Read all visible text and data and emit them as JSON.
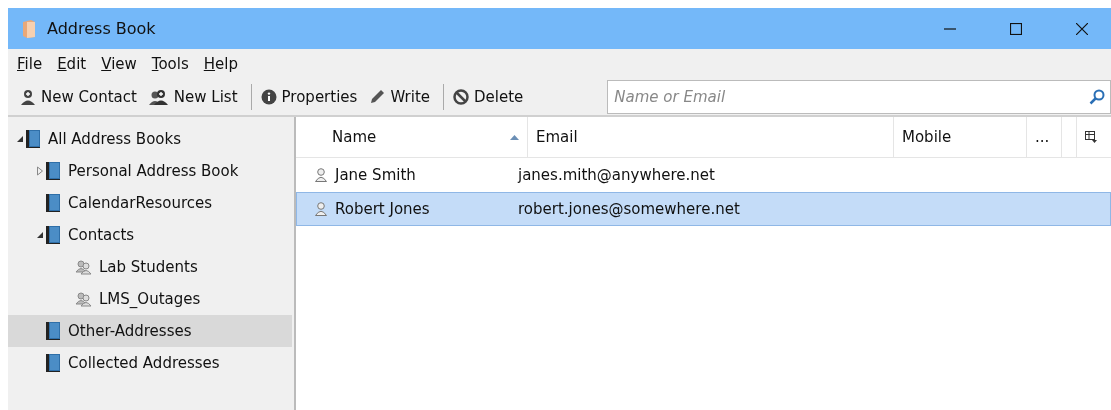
{
  "window": {
    "title": "Address Book"
  },
  "menu": [
    "File",
    "Edit",
    "View",
    "Tools",
    "Help"
  ],
  "toolbar": [
    {
      "kind": "new-contact",
      "label": "New Contact"
    },
    {
      "kind": "new-list",
      "label": "New List"
    },
    {
      "kind": "separator"
    },
    {
      "kind": "properties",
      "label": "Properties"
    },
    {
      "kind": "write",
      "label": "Write"
    },
    {
      "kind": "separator"
    },
    {
      "kind": "delete",
      "label": "Delete"
    }
  ],
  "search": {
    "placeholder": "Name or Email"
  },
  "sidebar": {
    "items": [
      {
        "label": "All Address Books",
        "kind": "book",
        "expanded": true,
        "selected": false,
        "children": [
          {
            "label": "Personal Address Book",
            "kind": "book",
            "expanded": false,
            "selected": false
          },
          {
            "label": "CalendarResources",
            "kind": "book",
            "selected": false
          },
          {
            "label": "Contacts",
            "kind": "book",
            "expanded": true,
            "selected": false,
            "children": [
              {
                "label": "Lab Students",
                "kind": "list",
                "selected": false
              },
              {
                "label": "LMS_Outages",
                "kind": "list",
                "selected": false
              }
            ]
          },
          {
            "label": "Other-Addresses",
            "kind": "book",
            "selected": true
          },
          {
            "label": "Collected Addresses",
            "kind": "book",
            "selected": false
          }
        ]
      }
    ]
  },
  "table": {
    "columns": [
      {
        "label": "Name",
        "sorted": true
      },
      {
        "label": "Email",
        "sorted": false
      },
      {
        "label": "Mobile",
        "sorted": false
      },
      {
        "label": "...",
        "sorted": false
      }
    ],
    "rows": [
      {
        "name": "Jane Smith",
        "email": "janes.mith@anywhere.net",
        "selected": false
      },
      {
        "name": "Robert Jones",
        "email": "robert.jones@somewhere.net",
        "selected": true
      }
    ]
  }
}
